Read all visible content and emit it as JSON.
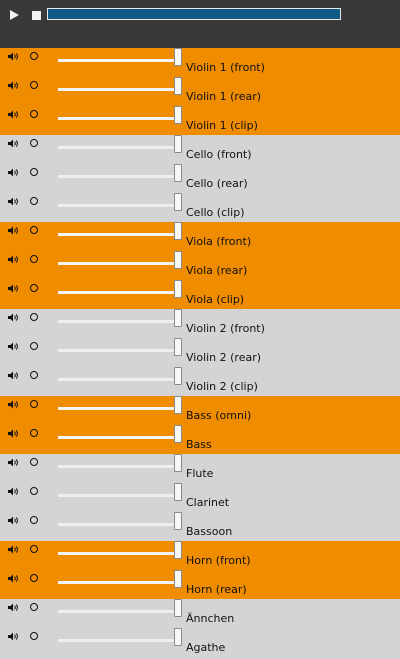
{
  "transport": {
    "play_icon": "play-icon",
    "stop_icon": "stop-icon",
    "progress": 1.0,
    "progress_color": "#0f5a84"
  },
  "colors": {
    "orange": "#f08c00",
    "gray": "#d4d4d4"
  },
  "tracks": [
    {
      "label": "Violin 1 (front)",
      "group": "orange",
      "volume": 1.0
    },
    {
      "label": "Violin 1 (rear)",
      "group": "orange",
      "volume": 1.0
    },
    {
      "label": "Violin 1 (clip)",
      "group": "orange",
      "volume": 1.0
    },
    {
      "label": "Cello (front)",
      "group": "gray",
      "volume": 1.0
    },
    {
      "label": "Cello (rear)",
      "group": "gray",
      "volume": 1.0
    },
    {
      "label": "Cello (clip)",
      "group": "gray",
      "volume": 1.0
    },
    {
      "label": "Viola (front)",
      "group": "orange",
      "volume": 1.0
    },
    {
      "label": "Viola (rear)",
      "group": "orange",
      "volume": 1.0
    },
    {
      "label": "Viola (clip)",
      "group": "orange",
      "volume": 1.0
    },
    {
      "label": "Violin 2 (front)",
      "group": "gray",
      "volume": 1.0
    },
    {
      "label": "Violin 2 (rear)",
      "group": "gray",
      "volume": 1.0
    },
    {
      "label": "Violin 2 (clip)",
      "group": "gray",
      "volume": 1.0
    },
    {
      "label": "Bass (omni)",
      "group": "orange",
      "volume": 1.0
    },
    {
      "label": "Bass",
      "group": "orange",
      "volume": 1.0
    },
    {
      "label": "Flute",
      "group": "gray",
      "volume": 1.0
    },
    {
      "label": "Clarinet",
      "group": "gray",
      "volume": 1.0
    },
    {
      "label": "Bassoon",
      "group": "gray",
      "volume": 1.0
    },
    {
      "label": "Horn (front)",
      "group": "orange",
      "volume": 1.0
    },
    {
      "label": "Horn (rear)",
      "group": "orange",
      "volume": 1.0
    },
    {
      "label": "Ännchen",
      "group": "gray",
      "volume": 1.0
    },
    {
      "label": "Agathe",
      "group": "gray",
      "volume": 1.0
    }
  ]
}
